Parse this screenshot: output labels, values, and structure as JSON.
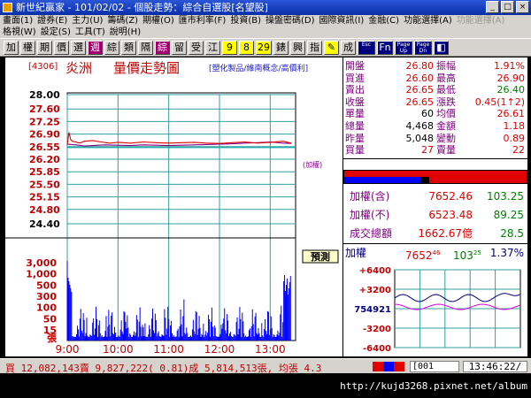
{
  "window": {
    "title": "新世紀贏家 - 101/02/02 - 個股走勢：綜合自選股[名望股]"
  },
  "menu": {
    "row1": [
      {
        "label": "畫面(1)",
        "dim": false
      },
      {
        "label": "證券(E)",
        "dim": false
      },
      {
        "label": "主力(U)",
        "dim": false
      },
      {
        "label": "籌碼(Z)",
        "dim": false
      },
      {
        "label": "期權(O)",
        "dim": false
      },
      {
        "label": "匯市利率(F)",
        "dim": false
      },
      {
        "label": "投資(B)",
        "dim": false
      },
      {
        "label": "操盤密碼(D)",
        "dim": false
      },
      {
        "label": "國際資訊(I)",
        "dim": false
      },
      {
        "label": "金融(C)",
        "dim": false
      },
      {
        "label": "功能選擇(A)",
        "dim": false
      },
      {
        "label": "功能選擇(A)",
        "dim": true
      }
    ],
    "row2": [
      {
        "label": "格視(W)"
      },
      {
        "label": "設定(S)"
      },
      {
        "label": "工具(T)"
      },
      {
        "label": "說明(H)"
      }
    ]
  },
  "toolbar": {
    "buttons": [
      {
        "label": "加",
        "bg": "#d6d3ce",
        "color": "#000"
      },
      {
        "label": "權",
        "bg": "#d6d3ce",
        "color": "#000"
      },
      {
        "label": "期",
        "bg": "#d6d3ce",
        "color": "#000"
      },
      {
        "label": "價",
        "bg": "#d6d3ce",
        "color": "#000"
      },
      {
        "label": "選",
        "bg": "#d6d3ce",
        "color": "#000"
      },
      {
        "label": "週",
        "bg": "#a0006e",
        "color": "#fff"
      },
      {
        "label": "綜",
        "bg": "#d6d3ce",
        "color": "#000"
      },
      {
        "label": "類",
        "bg": "#d6d3ce",
        "color": "#000"
      },
      {
        "label": "隔",
        "bg": "#d6d3ce",
        "color": "#000"
      },
      {
        "label": "綜",
        "bg": "#a0006e",
        "color": "#fff"
      },
      {
        "label": "留",
        "bg": "#d6d3ce",
        "color": "#000"
      },
      {
        "label": "受",
        "bg": "#d6d3ce",
        "color": "#000"
      },
      {
        "label": "江",
        "bg": "#d6d3ce",
        "color": "#000"
      },
      {
        "label": "9",
        "bg": "#ffff00",
        "color": "#000"
      },
      {
        "label": "8",
        "bg": "#ffff00",
        "color": "#000"
      },
      {
        "label": "29",
        "bg": "#ffff00",
        "color": "#000"
      },
      {
        "label": "錶",
        "bg": "#d6d3ce",
        "color": "#000"
      },
      {
        "label": "興",
        "bg": "#d6d3ce",
        "color": "#000"
      },
      {
        "label": "指",
        "bg": "#d6d3ce",
        "color": "#000"
      },
      {
        "label": "✎",
        "bg": "#ffff00",
        "color": "#000"
      },
      {
        "label": "成",
        "bg": "#d6d3ce",
        "color": "#000"
      },
      {
        "label": "Esc",
        "bg": "#000080",
        "color": "#fff"
      },
      {
        "label": "Fn",
        "bg": "#000080",
        "color": "#fff"
      },
      {
        "label": "Page Up",
        "bg": "#000080",
        "color": "#fff"
      },
      {
        "label": "Page Dn",
        "bg": "#000080",
        "color": "#fff"
      },
      {
        "label": "◧",
        "bg": "#000080",
        "color": "#fff"
      }
    ]
  },
  "chart": {
    "code": "[4306]",
    "name": "炎洲",
    "title": "量價走勢圖",
    "categories": "[塑化製品/維南概念/高價利]",
    "ref_label": "(加權)",
    "vol_label": "預測",
    "vol_unit": "張",
    "colors": {
      "price": "#e00000",
      "index": "#800080",
      "volume": "#0000ff",
      "ref": "#00a0a0",
      "axis": "#c00000",
      "grid": "#30a0a0"
    }
  },
  "chart_data": {
    "type": "line",
    "price_ticks": [
      "28.00",
      "27.60",
      "27.25",
      "26.90",
      "26.55",
      "26.20",
      "25.85",
      "25.50",
      "25.15",
      "24.80",
      "24.40"
    ],
    "price_range": [
      24.4,
      28.0
    ],
    "reference_price": 26.55,
    "time_ticks": [
      "9:00",
      "10:00",
      "11:00",
      "12:00",
      "13:00"
    ],
    "volume_ticks": [
      "3,000",
      "1,000",
      "500",
      "300",
      "100",
      "50",
      "15"
    ],
    "price_series": {
      "name": "炎洲",
      "x_minutes": [
        0,
        2,
        4,
        6,
        10,
        15,
        20,
        30,
        40,
        50,
        60,
        75,
        90,
        105,
        120,
        135,
        150,
        165,
        180,
        195,
        210,
        225,
        240,
        255,
        265
      ],
      "values": [
        26.6,
        26.95,
        26.75,
        26.7,
        26.68,
        26.65,
        26.7,
        26.72,
        26.68,
        26.65,
        26.67,
        26.65,
        26.68,
        26.66,
        26.65,
        26.66,
        26.67,
        26.65,
        26.64,
        26.66,
        26.68,
        26.65,
        26.67,
        26.7,
        26.65
      ]
    },
    "index_series": {
      "name": "加權",
      "x_minutes": [
        0,
        10,
        20,
        30,
        45,
        60,
        75,
        90,
        105,
        120,
        135,
        150,
        165,
        180,
        195,
        210,
        225,
        240,
        255,
        265
      ],
      "values": [
        26.62,
        26.6,
        26.57,
        26.58,
        26.6,
        26.59,
        26.58,
        26.6,
        26.59,
        26.58,
        26.59,
        26.6,
        26.61,
        26.62,
        26.63,
        26.65,
        26.66,
        26.68,
        26.65,
        26.64
      ]
    }
  },
  "quote": {
    "rows": [
      {
        "l1": "開盤",
        "v1": "26.80",
        "c1": "red",
        "l2": "振幅",
        "v2": "1.91%",
        "c2": "red"
      },
      {
        "l1": "買進",
        "v1": "26.60",
        "c1": "red",
        "l2": "最高",
        "v2": "26.90",
        "c2": "red"
      },
      {
        "l1": "賣出",
        "v1": "26.65",
        "c1": "red",
        "l2": "最低",
        "v2": "26.40",
        "c2": "green"
      },
      {
        "l1": "收盤",
        "v1": "26.65",
        "c1": "red",
        "l2": "漲跌",
        "v2": "0.45(1↑2)",
        "c2": "red"
      },
      {
        "l1": "單量",
        "v1": "60",
        "c1": "",
        "l2": "均價",
        "v2": "26.61",
        "c2": "red"
      },
      {
        "l1": "總量",
        "v1": "4,468",
        "c1": "",
        "l2": "金額",
        "v2": "1.18",
        "c2": "red"
      },
      {
        "l1": "昨量",
        "v1": "5,048",
        "c1": "",
        "l2": "變動",
        "v2": "0.89",
        "c2": "red"
      },
      {
        "l1": "買量",
        "v1": "27",
        "c1": "red",
        "l2": "賣量",
        "v2": "22",
        "c2": "red"
      }
    ]
  },
  "index": {
    "rows": [
      {
        "label": "加權(含)",
        "value": "7652.46",
        "value2": "103.25"
      },
      {
        "label": "加權(不)",
        "value": "6523.48",
        "value2": "89.25"
      },
      {
        "label": "成交總額",
        "value": "1662.67億",
        "value2": "28.5"
      }
    ]
  },
  "mini": {
    "label": "加權",
    "value": "7652",
    "value_dec": "46",
    "change": "103",
    "change_dec": "25",
    "pct": "1.37%",
    "ticks": [
      "+6400",
      "+3200",
      "754921",
      "-3200",
      "-6400"
    ]
  },
  "status": {
    "text": "買 12,082,143賣 9,827,222( 0.81)成 5,814,513張, 均張 4.3",
    "code": "[001",
    "clock": "13:46:22/"
  },
  "watermark": "http://kujd3268.pixnet.net/album"
}
